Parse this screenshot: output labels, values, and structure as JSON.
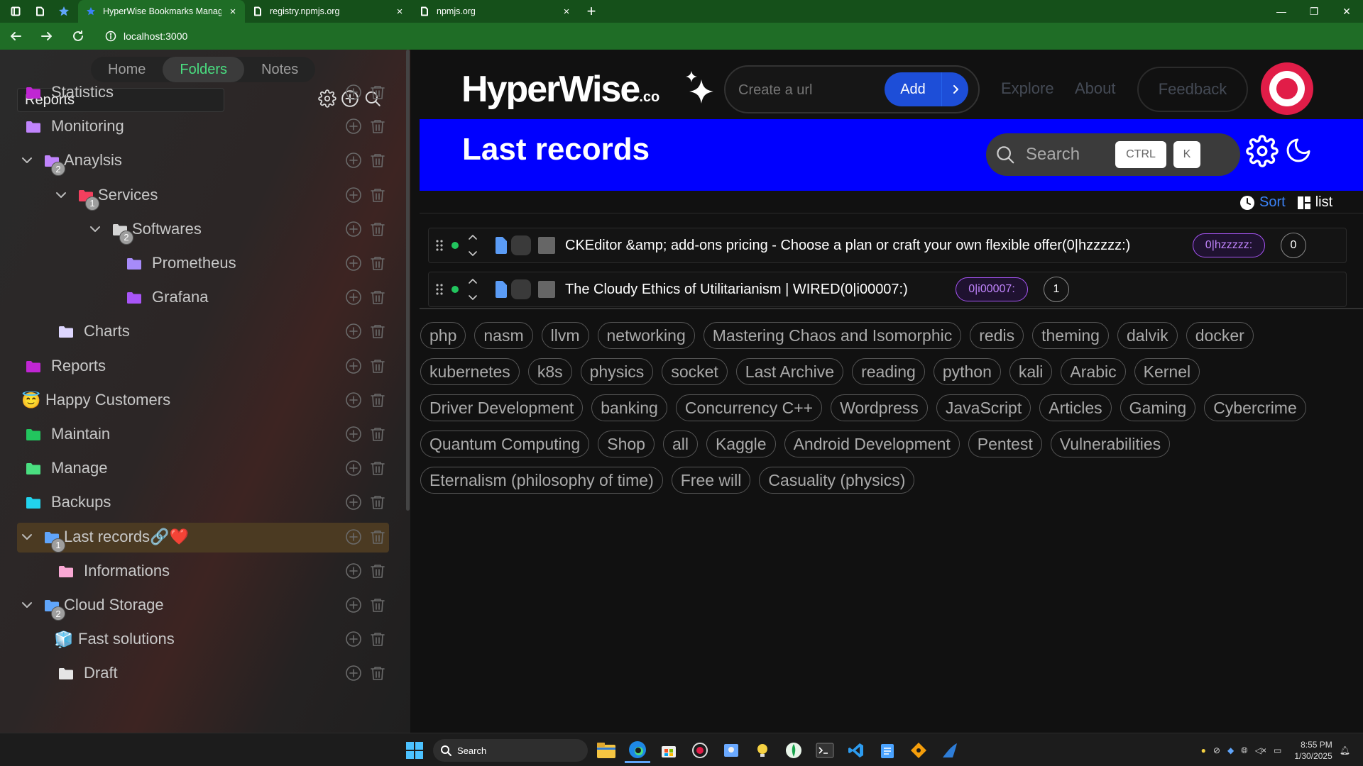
{
  "browser": {
    "tabs": [
      {
        "title": "HyperWise Bookmarks Manager",
        "active": true
      },
      {
        "title": "registry.npmjs.org",
        "active": false
      },
      {
        "title": "npmjs.org",
        "active": false
      }
    ],
    "url": "localhost:3000"
  },
  "sidebar": {
    "nav": [
      "Home",
      "Folders",
      "Notes"
    ],
    "active_nav": "Folders",
    "search_value": "Reports",
    "tree": [
      {
        "label": "Statistics",
        "color": "#c026d3",
        "depth": 0
      },
      {
        "label": "Monitoring",
        "color": "#c084fc",
        "depth": 0
      },
      {
        "label": "Anaylsis",
        "color": "#c084fc",
        "depth": 0,
        "expanded": true,
        "badge": "2"
      },
      {
        "label": "Services",
        "color": "#f43f5e",
        "depth": 1,
        "expanded": true,
        "badge": "1"
      },
      {
        "label": "Softwares",
        "color": "#d4d4d4",
        "depth": 2,
        "expanded": true,
        "badge": "2"
      },
      {
        "label": "Prometheus",
        "color": "#a78bfa",
        "depth": 3
      },
      {
        "label": "Grafana",
        "color": "#a855f7",
        "depth": 3
      },
      {
        "label": "Charts",
        "color": "#ddd6fe",
        "depth": 1
      },
      {
        "label": "Reports",
        "color": "#c026d3",
        "depth": 0
      },
      {
        "label": "Happy Customers",
        "emoji": "😇",
        "depth": 0
      },
      {
        "label": "Maintain",
        "color": "#22c55e",
        "depth": 0
      },
      {
        "label": "Manage",
        "color": "#4ade80",
        "depth": 0
      },
      {
        "label": "Backups",
        "color": "#22d3ee",
        "depth": 0
      },
      {
        "label": "Last records",
        "suffix": "🔗❤️",
        "color": "#60a5fa",
        "depth": 0,
        "expanded": true,
        "badge": "1",
        "selected": true
      },
      {
        "label": "Informations",
        "color": "#f9a8d4",
        "depth": 1
      },
      {
        "label": "Cloud Storage",
        "color": "#60a5fa",
        "depth": 0,
        "expanded": true,
        "badge": "2"
      },
      {
        "label": "Fast solutions",
        "emoji": "🧊",
        "depth": 1
      },
      {
        "label": "Draft",
        "color": "#e5e5e5",
        "depth": 1
      }
    ]
  },
  "header": {
    "logo": "HyperWise",
    "logo_suffix": ".co",
    "create_placeholder": "Create a url",
    "add_label": "Add",
    "links": [
      "Explore",
      "About"
    ],
    "feedback": "Feedback"
  },
  "banner": {
    "title": "Last records",
    "search_label": "Search",
    "kbd1": "CTRL",
    "kbd2": "K"
  },
  "sortbar": {
    "sort": "Sort",
    "view": "list"
  },
  "records": [
    {
      "title": "CKEditor &amp; add-ons pricing - Choose a plan or craft your own flexible offer(0|hzzzzz:)",
      "tag": "0|hzzzzz:",
      "count": "0"
    },
    {
      "title": "The Cloudy Ethics of Utilitarianism | WIRED(0|i00007:)",
      "tag": "0|i00007:",
      "count": "1"
    }
  ],
  "tags": [
    "php",
    "nasm",
    "llvm",
    "networking",
    "Mastering Chaos and Isomorphic",
    "redis",
    "theming",
    "dalvik",
    "docker",
    "kubernetes",
    "k8s",
    "physics",
    "socket",
    "Last Archive",
    "reading",
    "python",
    "kali",
    "Arabic",
    "Kernel",
    "Driver Development",
    "banking",
    "Concurrency C++",
    "Wordpress",
    "JavaScript",
    "Articles",
    "Gaming",
    "Cybercrime",
    "Quantum Computing",
    "Shop",
    "all",
    "Kaggle",
    "Android Development",
    "Pentest",
    "Vulnerabilities",
    "Eternalism (philosophy of time)",
    "Free will",
    "Casuality (physics)"
  ],
  "taskbar": {
    "search": "Search",
    "time": "8:55 PM",
    "date": "1/30/2025"
  },
  "colors": {
    "accent_green": "#4ade80",
    "banner_blue": "#0000ff",
    "add_blue": "#1d4ed8",
    "tag_purple": "#a855f7"
  }
}
